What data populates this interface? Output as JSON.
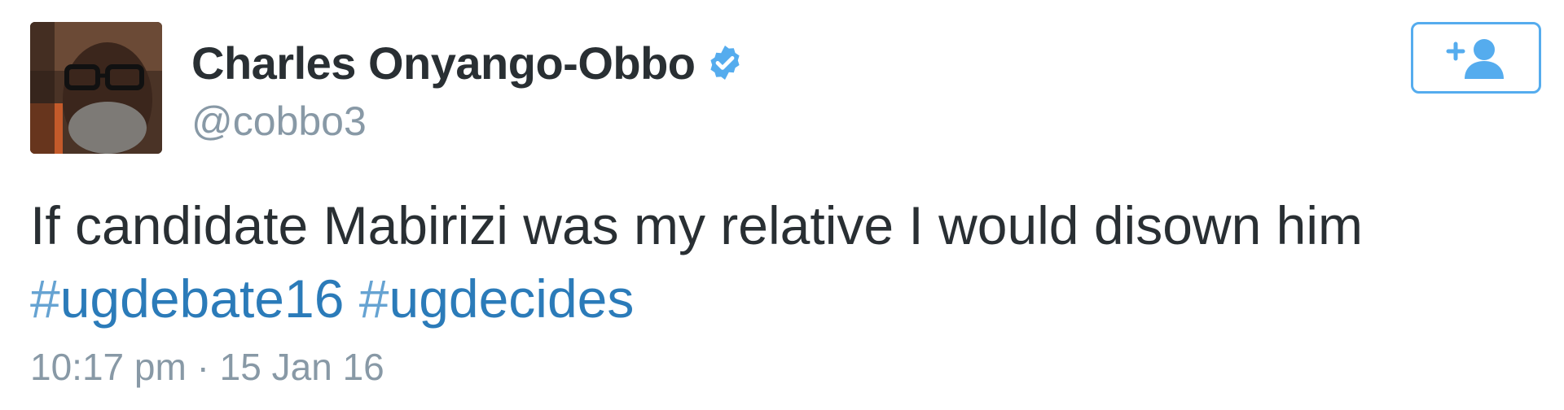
{
  "user": {
    "display_name": "Charles Onyango-Obbo",
    "handle": "@cobbo3",
    "verified": true,
    "avatar_icon": "user-avatar-photo"
  },
  "follow_button": {
    "icon": "add-user-icon",
    "accent_color": "#55acee"
  },
  "tweet": {
    "text": "If candidate Mabirizi was my relative I would disown him",
    "hashtags": [
      {
        "hash": "#",
        "tag": "ugdebate16"
      },
      {
        "hash": "#",
        "tag": "ugdecides"
      }
    ],
    "link_color": "#2b7bb9"
  },
  "timestamp": "10:17 pm · 15 Jan 16"
}
